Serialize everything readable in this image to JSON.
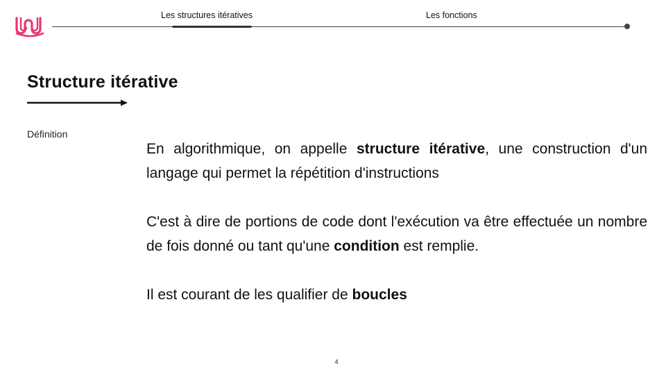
{
  "nav": {
    "tabs": [
      {
        "label": "Les structures itératives",
        "active": true
      },
      {
        "label": "Les fonctions",
        "active": false
      }
    ]
  },
  "slide": {
    "title": "Structure itérative",
    "label": "Définition",
    "paragraph1": {
      "t1": "En algorithmique, on appelle ",
      "b1": "structure itérative",
      "t2": ", une construction d'un langage qui permet la répétition d'instructions"
    },
    "paragraph2": {
      "t1": "C'est à dire de portions de code dont l'exécution va être effectuée un nombre de fois donné ou tant qu'une ",
      "b1": "condition",
      "t2": " est remplie."
    },
    "paragraph3": {
      "t1": "Il est courant de les qualifier de ",
      "b1": "boucles"
    },
    "page_number": "4"
  },
  "colors": {
    "logo": "#e8366f",
    "text": "#111111",
    "nav_line": "#444444"
  },
  "icons": {
    "logo": "wave-logo-icon",
    "arrow": "arrow-right-icon",
    "timeline_end": "dot-icon"
  }
}
